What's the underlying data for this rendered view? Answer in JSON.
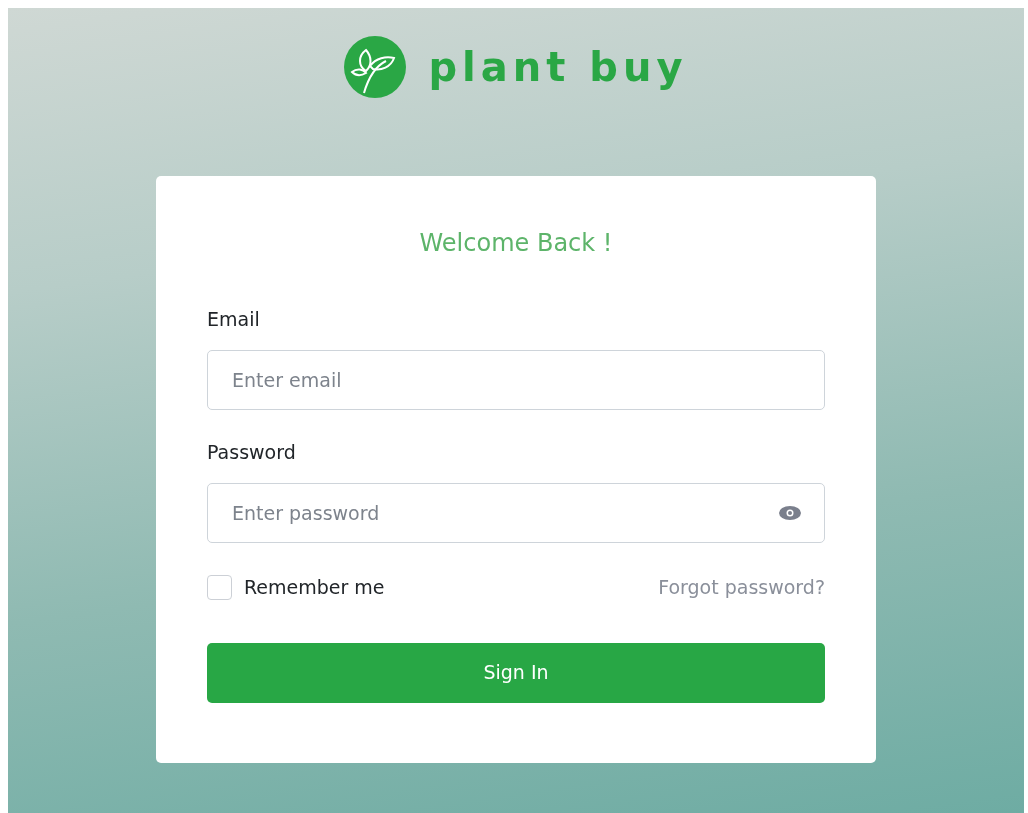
{
  "logo": {
    "text": "plant buy"
  },
  "card": {
    "title": "Welcome Back !",
    "fields": [
      {
        "label": "Email",
        "placeholder": "Enter email",
        "kind": "text"
      },
      {
        "label": "Password",
        "placeholder": "Enter password",
        "kind": "password"
      }
    ],
    "remember": {
      "label": "Remember me",
      "checked": false
    },
    "forgot_link": "Forgot password?",
    "button": "Sign In"
  }
}
